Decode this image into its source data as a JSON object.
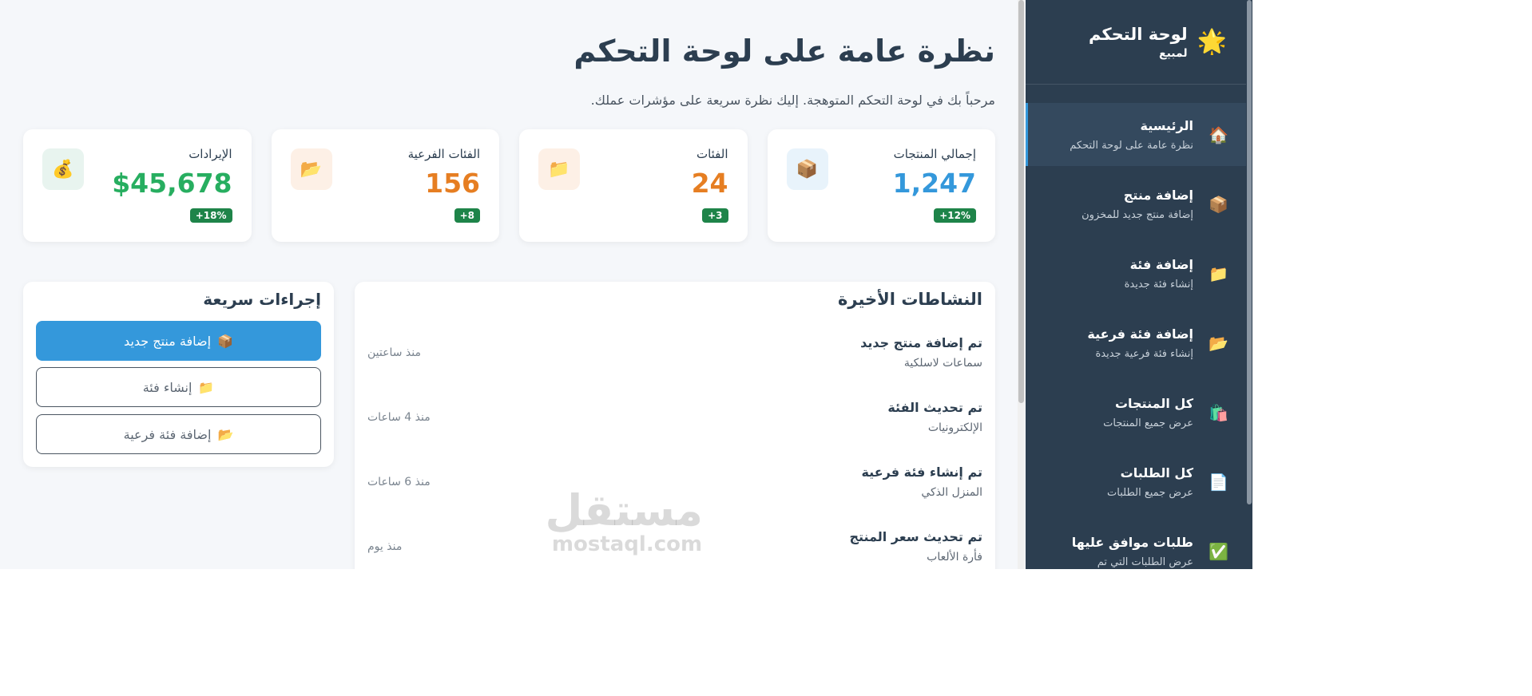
{
  "sidebar": {
    "brand_title": "لوحة التحكم",
    "brand_subtitle": "لمبيع",
    "brand_icon": "sun-icon",
    "items": [
      {
        "label": "الرئيسية",
        "desc": "نظرة عامة على لوحة التحكم",
        "icon": "home-icon",
        "active": true
      },
      {
        "label": "إضافة منتج",
        "desc": "إضافة منتج جديد للمخزون",
        "icon": "box-icon"
      },
      {
        "label": "إضافة فئة",
        "desc": "إنشاء فئة جديدة",
        "icon": "folder-icon"
      },
      {
        "label": "إضافة فئة فرعية",
        "desc": "إنشاء فئة فرعية جديدة",
        "icon": "open-folder-icon"
      },
      {
        "label": "كل المنتجات",
        "desc": "عرض جميع المنتجات",
        "icon": "shopping-bag-icon"
      },
      {
        "label": "كل الطلبات",
        "desc": "عرض جميع الطلبات",
        "icon": "receipt-icon"
      },
      {
        "label": "طلبات موافق عليها",
        "desc": "عرض الطلبات التي تم",
        "icon": "check-icon"
      }
    ]
  },
  "header": {
    "title": "نظرة عامة على لوحة التحكم",
    "subtitle": "مرحباً بك في لوحة التحكم المتوهجة. إليك نظرة سريعة على مؤشرات عملك."
  },
  "stats": [
    {
      "label": "إجمالي المنتجات",
      "value": "1,247",
      "badge": "12%+",
      "icon": "box-icon",
      "color": "#3498db",
      "icon_bg": "#e8f3fb"
    },
    {
      "label": "الفئات",
      "value": "24",
      "badge": "3+",
      "icon": "folder-icon",
      "color": "#e67e22",
      "icon_bg": "#fdf0e6"
    },
    {
      "label": "الفئات الفرعية",
      "value": "156",
      "badge": "8+",
      "icon": "open-folder-icon",
      "color": "#e67e22",
      "icon_bg": "#fdf0e6"
    },
    {
      "label": "الإيرادات",
      "value": "$45,678",
      "badge": "18%+",
      "icon": "money-bag-icon",
      "color": "#27ae60",
      "icon_bg": "#e8f4ef"
    }
  ],
  "activity": {
    "title": "النشاطات الأخيرة",
    "items": [
      {
        "title": "تم إضافة منتج جديد",
        "sub": "سماعات لاسلكية",
        "time": "منذ ساعتين"
      },
      {
        "title": "تم تحديث الفئة",
        "sub": "الإلكترونيات",
        "time": "منذ 4 ساعات"
      },
      {
        "title": "تم إنشاء فئة فرعية",
        "sub": "المنزل الذكي",
        "time": "منذ 6 ساعات"
      },
      {
        "title": "تم تحديث سعر المنتج",
        "sub": "فأرة الألعاب",
        "time": "منذ يوم"
      }
    ]
  },
  "quick": {
    "title": "إجراءات سريعة",
    "buttons": [
      {
        "label": "إضافة منتج جديد",
        "icon": "box-icon"
      },
      {
        "label": "إنشاء فئة",
        "icon": "folder-icon"
      },
      {
        "label": "إضافة فئة فرعية",
        "icon": "open-folder-icon"
      }
    ]
  },
  "watermark": {
    "ar": "مستقل",
    "en": "mostaql.com"
  }
}
